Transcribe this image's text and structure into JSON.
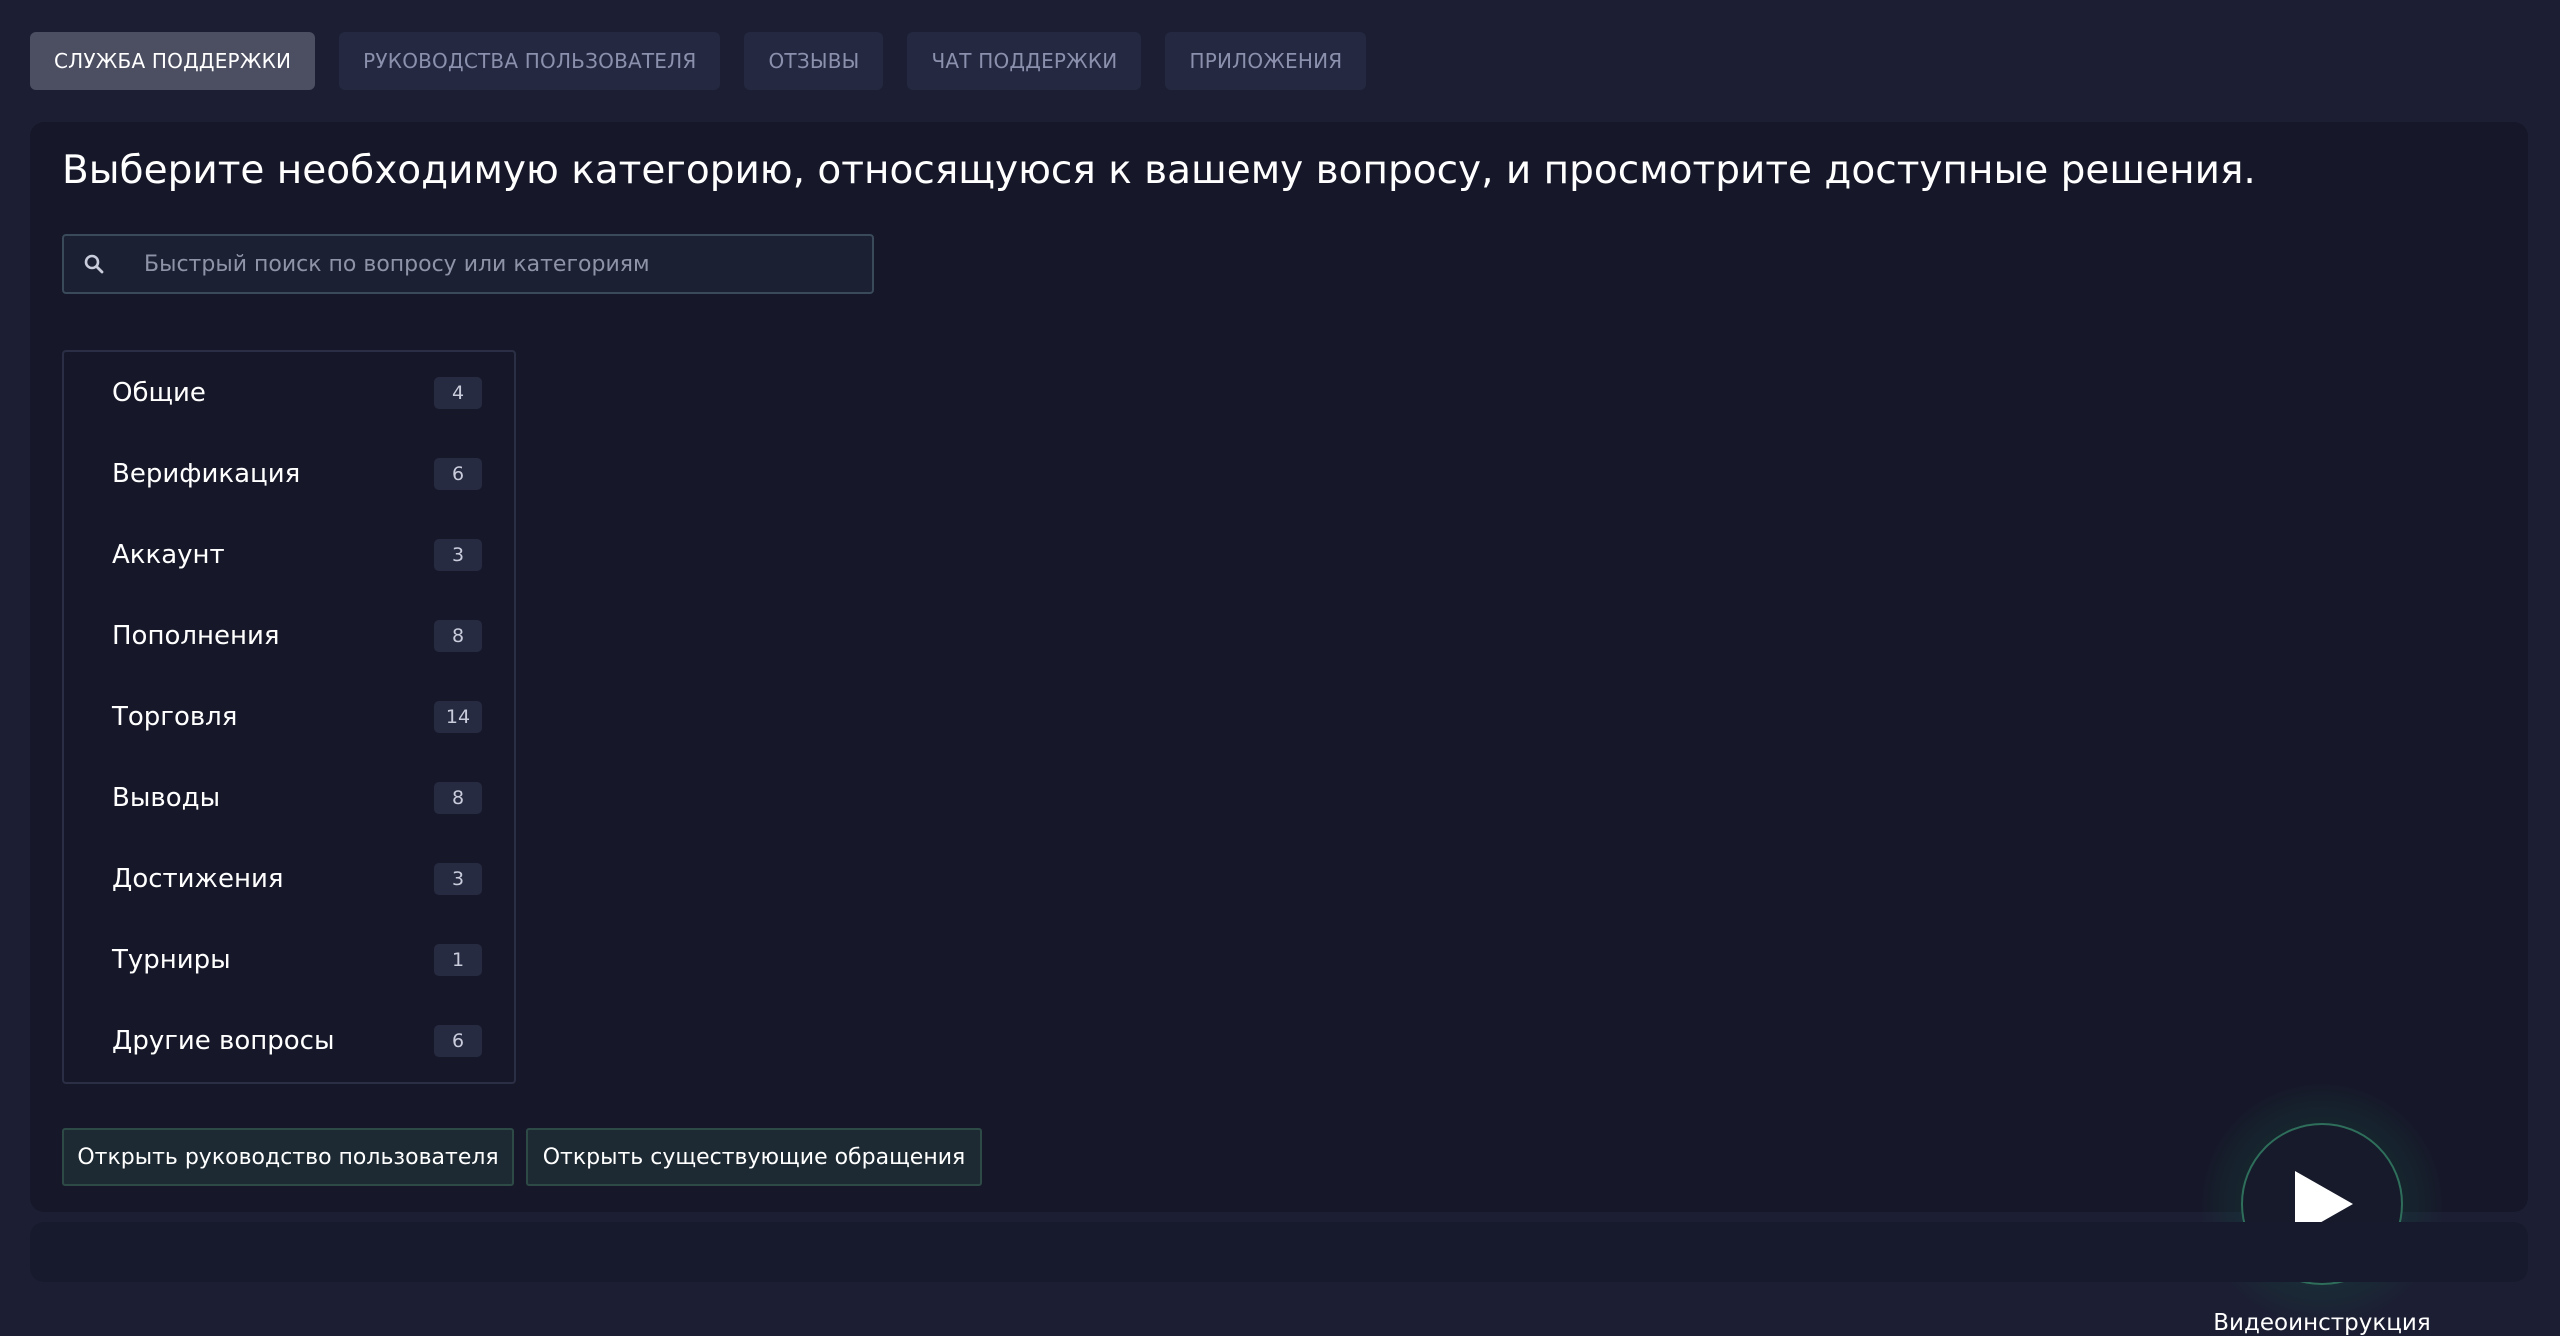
{
  "tabs": [
    {
      "label": "СЛУЖБА ПОДДЕРЖКИ",
      "active": true
    },
    {
      "label": "РУКОВОДСТВА ПОЛЬЗОВАТЕЛЯ",
      "active": false
    },
    {
      "label": "ОТЗЫВЫ",
      "active": false
    },
    {
      "label": "ЧАТ ПОДДЕРЖКИ",
      "active": false
    },
    {
      "label": "ПРИЛОЖЕНИЯ",
      "active": false
    }
  ],
  "main": {
    "heading": "Выберите необходимую категорию, относящуюся к вашему вопросу, и просмотрите доступные решения.",
    "search": {
      "placeholder": "Быстрый поиск по вопросу или категориям",
      "value": "",
      "icon": "search-icon"
    },
    "categories": [
      {
        "label": "Общие",
        "count": "4"
      },
      {
        "label": "Верификация",
        "count": "6"
      },
      {
        "label": "Аккаунт",
        "count": "3"
      },
      {
        "label": "Пополнения",
        "count": "8"
      },
      {
        "label": "Торговля",
        "count": "14"
      },
      {
        "label": "Выводы",
        "count": "8"
      },
      {
        "label": "Достижения",
        "count": "3"
      },
      {
        "label": "Турниры",
        "count": "1"
      },
      {
        "label": "Другие вопросы",
        "count": "6"
      }
    ],
    "buttons": {
      "open_guide": "Открыть руководство пользователя",
      "open_tickets": "Открыть существующие обращения"
    },
    "video": {
      "label": "Видеоинструкция",
      "icon": "play-icon"
    }
  },
  "colors": {
    "background": "#1c1f33",
    "panel": "#161829",
    "tab": "#242840",
    "tab_active": "#4c4f62",
    "accent_green": "#2e6e5a"
  }
}
